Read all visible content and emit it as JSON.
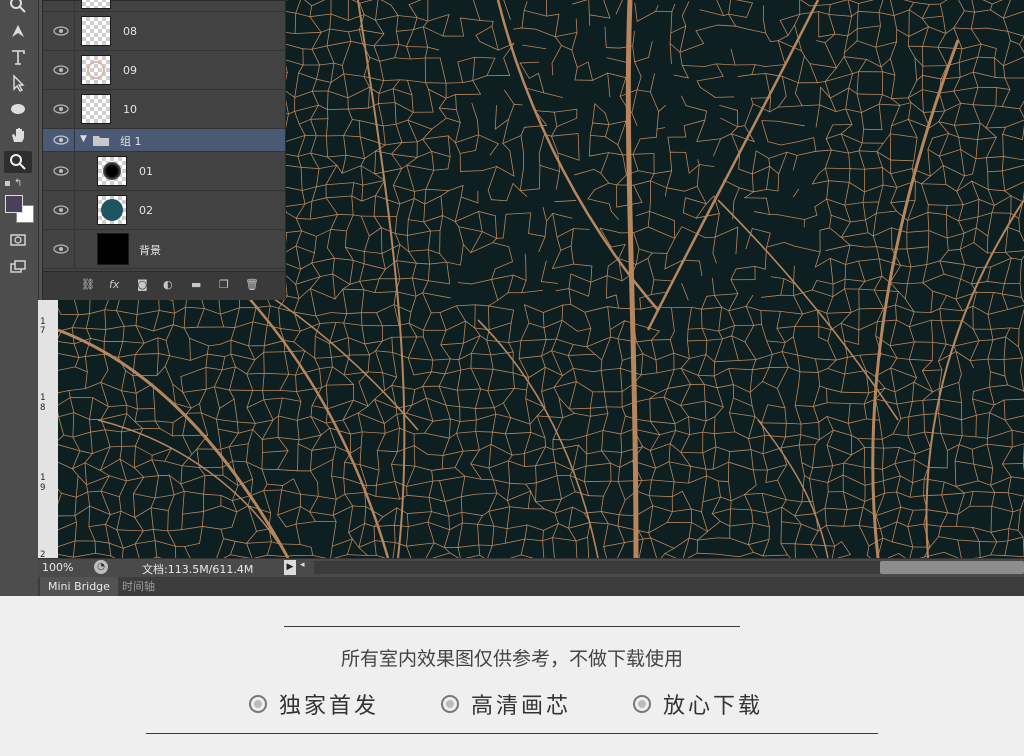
{
  "colors": {
    "canvas_bg": "#0d1f20",
    "vein": "#b8865e",
    "group_highlight": "#4a5a74",
    "thumb_02": "#1e5560"
  },
  "toolbar": {
    "tools": [
      "zoom-icon",
      "pen-icon",
      "type-icon",
      "path-select-icon",
      "ellipse-icon",
      "hand-icon",
      "zoom-active-icon"
    ]
  },
  "ruler": {
    "ticks": [
      "1",
      "7",
      "1",
      "8",
      "1",
      "9",
      "2"
    ]
  },
  "layers": {
    "rows": [
      {
        "name": "08",
        "thumb": "checker"
      },
      {
        "name": "09",
        "thumb": "checker-ring"
      },
      {
        "name": "10",
        "thumb": "checker"
      },
      {
        "name": "组 1",
        "thumb": "folder"
      },
      {
        "name": "01",
        "thumb": "black-blur"
      },
      {
        "name": "02",
        "thumb": "teal-circle"
      },
      {
        "name": "背景",
        "thumb": "black"
      }
    ],
    "footer_icons": [
      "link-icon",
      "fx-icon",
      "mask-icon",
      "adjustment-icon",
      "folder-icon",
      "new-layer-icon",
      "trash-icon"
    ],
    "fx_label": "fx"
  },
  "status": {
    "zoom": "100%",
    "doc_info": "文档:113.5M/611.4M"
  },
  "bottom_tabs": [
    {
      "label": "Mini Bridge",
      "active": true
    },
    {
      "label": "时间轴",
      "active": false
    }
  ],
  "caption": {
    "tagline": "所有室内效果图仅供参考，不做下载使用",
    "features": [
      "独家首发",
      "高清画芯",
      "放心下载"
    ]
  }
}
